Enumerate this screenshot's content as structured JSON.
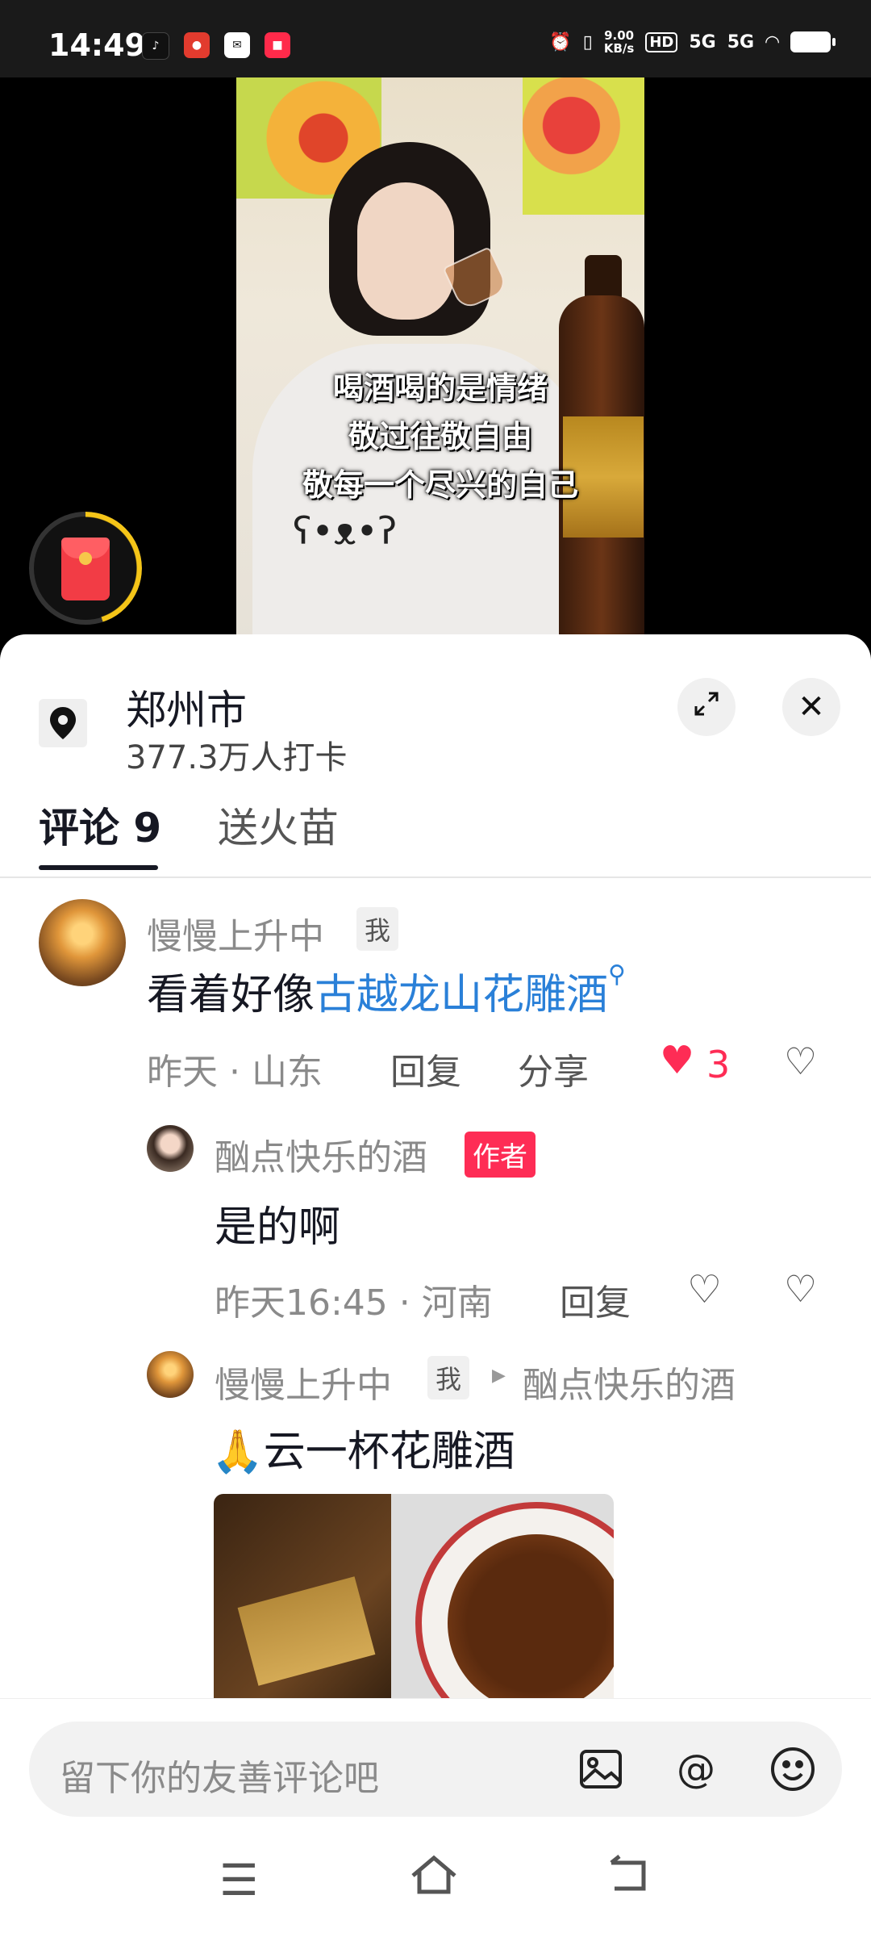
{
  "status_bar": {
    "time": "14:49",
    "speed_value": "9.00",
    "speed_unit": "KB/s",
    "hd": "HD",
    "net1": "5G",
    "net2": "5G"
  },
  "video": {
    "caption_lines": [
      "喝酒喝的是情绪",
      "敬过往敬自由",
      "敬每一个尽兴的自己"
    ]
  },
  "location": {
    "title": "郑州市",
    "subtitle": "377.3万人打卡"
  },
  "tabs": {
    "comments": "评论 9",
    "fire": "送火苗"
  },
  "comments": [
    {
      "user": "慢慢上升中",
      "badge": "我",
      "text_plain": "看着好像",
      "text_link": "古越龙山花雕酒",
      "meta": "昨天 · 山东",
      "reply": "回复",
      "share": "分享",
      "likes": "3"
    },
    {
      "user": "酗点快乐的酒",
      "badge": "作者",
      "text": "是的啊",
      "meta": "昨天16:45 · 河南",
      "reply": "回复"
    },
    {
      "user": "慢慢上升中",
      "badge": "我",
      "reply_to": "酗点快乐的酒",
      "emoji": "🙏",
      "text": "云一杯花雕酒"
    }
  ],
  "input": {
    "placeholder": "留下你的友善评论吧"
  },
  "icons": {
    "location": "location-pin-icon",
    "expand": "expand-icon",
    "close": "close-icon",
    "image": "image-icon",
    "mention": "at-icon",
    "emoji": "emoji-icon"
  },
  "colors": {
    "accent_red": "#fe2c55",
    "link_blue": "#2a80d8"
  }
}
